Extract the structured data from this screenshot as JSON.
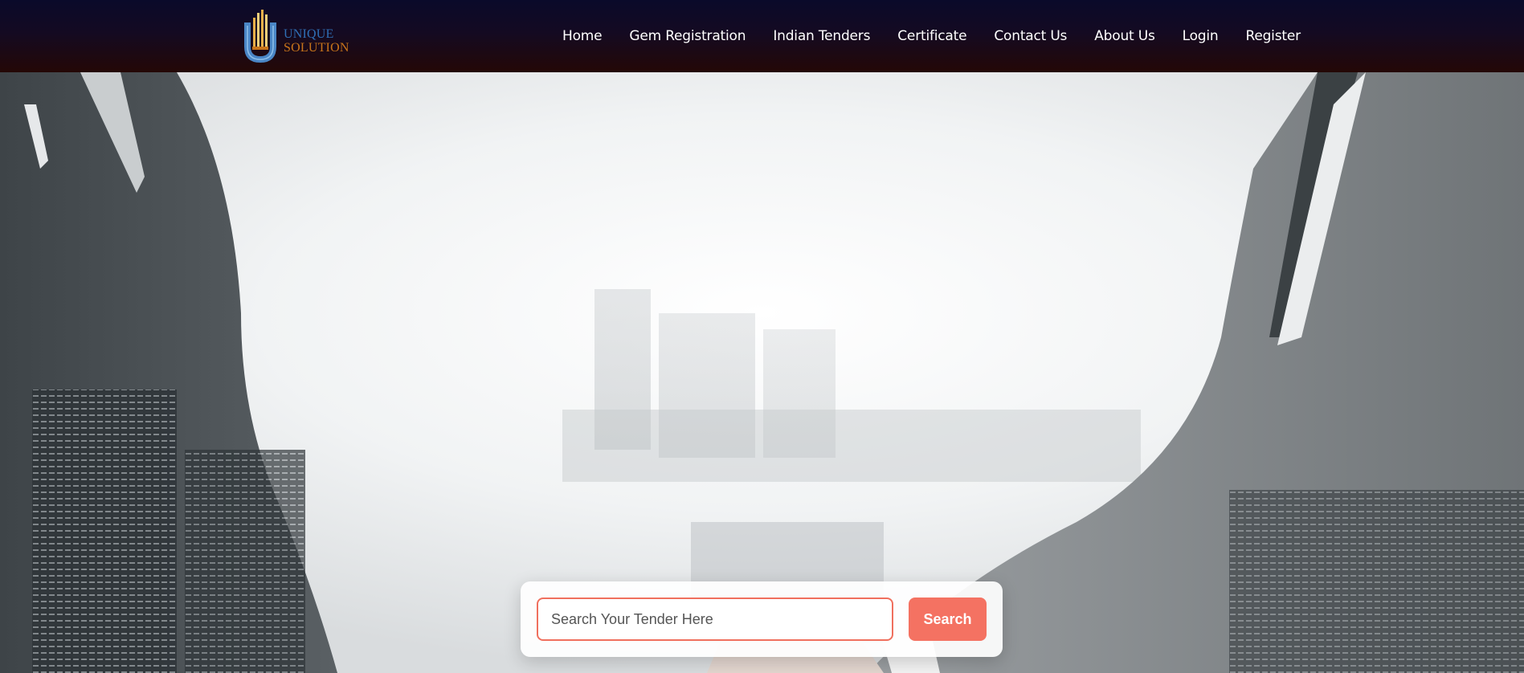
{
  "brand": {
    "logo_line1": "UNIQUE",
    "logo_line2": "SOLUTION",
    "colors": {
      "blue": "#2f6fb5",
      "orange": "#c8741a",
      "gold": "#e8b04a"
    }
  },
  "nav": {
    "items": [
      {
        "label": "Home"
      },
      {
        "label": "Gem Registration"
      },
      {
        "label": "Indian Tenders"
      },
      {
        "label": "Certificate"
      },
      {
        "label": "Contact Us"
      },
      {
        "label": "About Us"
      },
      {
        "label": "Login"
      },
      {
        "label": "Register"
      }
    ]
  },
  "hero": {
    "image": "businessmen-handshake-city-skyline-background"
  },
  "search": {
    "placeholder": "Search Your Tender Here",
    "value": "",
    "button_label": "Search",
    "accent_color": "#f47262"
  }
}
